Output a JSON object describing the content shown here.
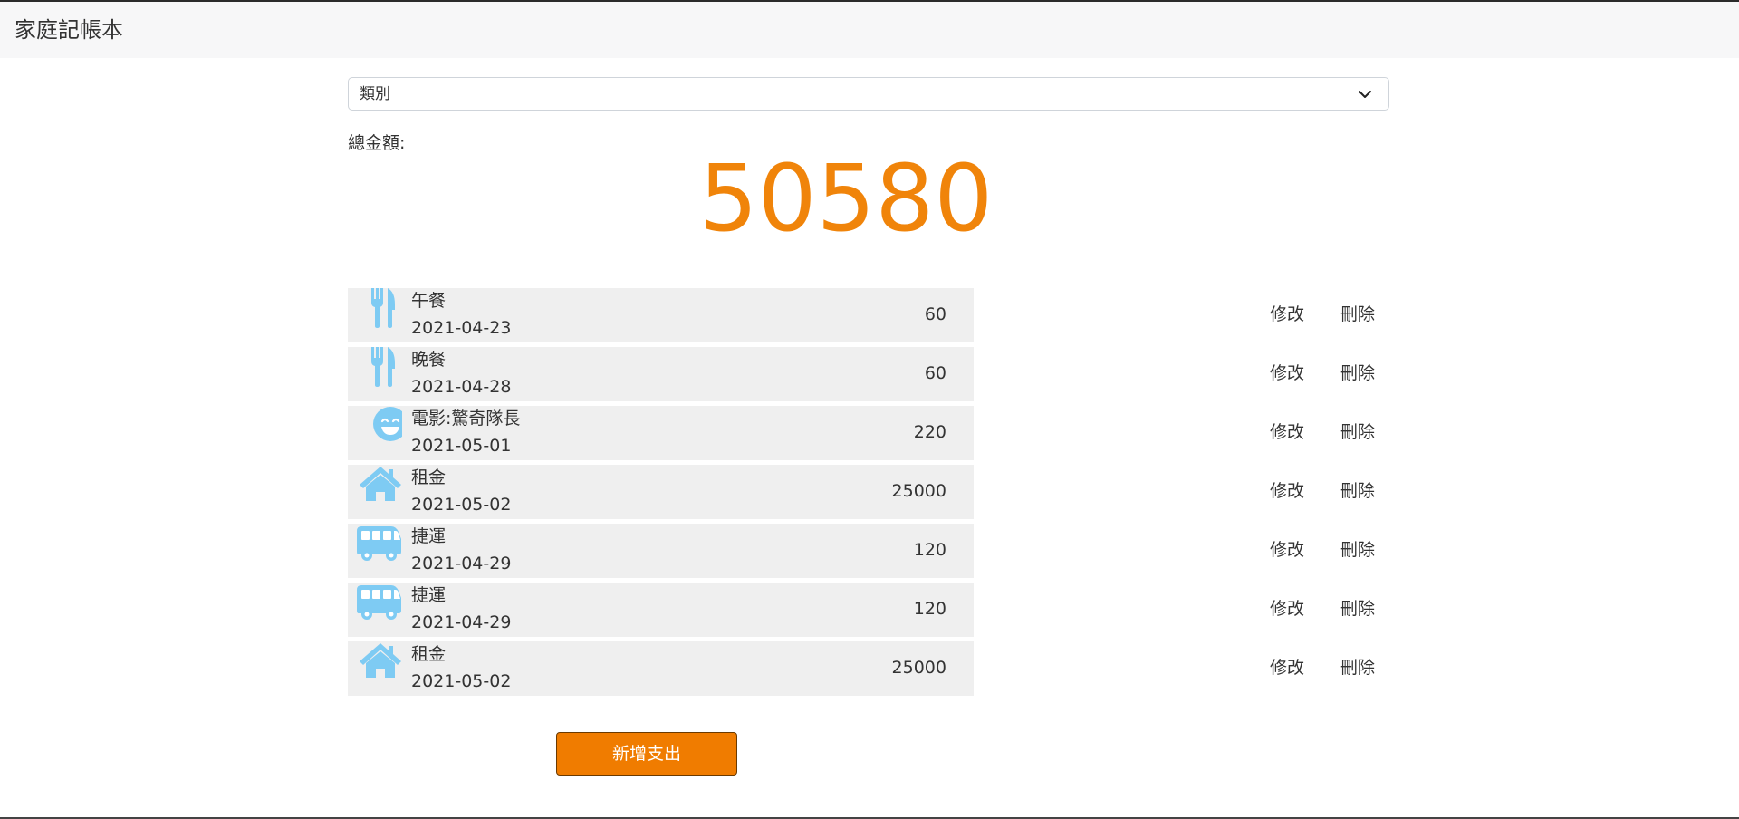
{
  "app": {
    "title": "家庭記帳本"
  },
  "filter": {
    "selected": "類別"
  },
  "summary": {
    "label": "總金額:",
    "amount": "50580",
    "accent_color": "#f0840a"
  },
  "expenses": [
    {
      "icon": "utensils-icon",
      "name": "午餐",
      "date": "2021-04-23",
      "amount": "60"
    },
    {
      "icon": "utensils-icon",
      "name": "晚餐",
      "date": "2021-04-28",
      "amount": "60"
    },
    {
      "icon": "smile-icon",
      "name": "電影:驚奇隊長",
      "date": "2021-05-01",
      "amount": "220"
    },
    {
      "icon": "home-icon",
      "name": "租金",
      "date": "2021-05-02",
      "amount": "25000"
    },
    {
      "icon": "bus-icon",
      "name": "捷運",
      "date": "2021-04-29",
      "amount": "120"
    },
    {
      "icon": "bus-icon",
      "name": "捷運",
      "date": "2021-04-29",
      "amount": "120"
    },
    {
      "icon": "home-icon",
      "name": "租金",
      "date": "2021-05-02",
      "amount": "25000"
    }
  ],
  "actions": {
    "edit_label": "修改",
    "delete_label": "刪除",
    "add_label": "新增支出"
  },
  "colors": {
    "icon": "#7ecbf3",
    "row_background": "#efefef",
    "button": "#f07c00"
  }
}
